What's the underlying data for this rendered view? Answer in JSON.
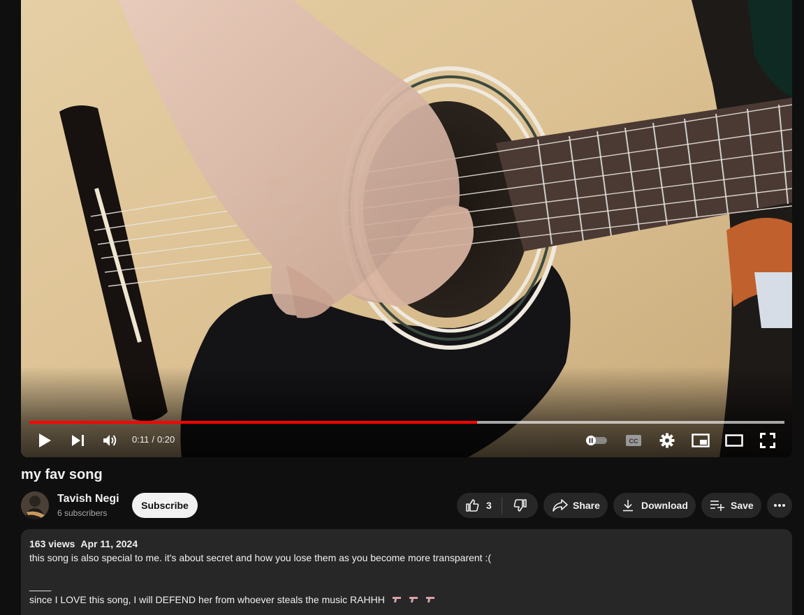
{
  "player": {
    "progress_fraction": 0.593,
    "current_time": "0:11",
    "separator": "/",
    "duration": "0:20",
    "icons": [
      "play-icon",
      "next-icon",
      "volume-icon",
      "autoplay-toggle-icon",
      "captions-icon",
      "settings-icon",
      "miniplayer-icon",
      "theater-icon",
      "fullscreen-icon"
    ],
    "colors": {
      "played": "#ff0000"
    }
  },
  "video": {
    "title": "my fav song"
  },
  "channel": {
    "name": "Tavish Negi",
    "subscribers": "6 subscribers",
    "subscribe_label": "Subscribe"
  },
  "actions": {
    "like_count": "3",
    "share_label": "Share",
    "download_label": "Download",
    "save_label": "Save"
  },
  "description": {
    "views": "163 views",
    "date": "Apr 11, 2024",
    "line1": "this song is also special to me. it's about secret and how you lose them as you become more transparent :(",
    "line2": "____",
    "line3": "since I LOVE this song, I will DEFEND her from whoever steals the music RAHHH",
    "emoji_icons": [
      "gun-icon",
      "gun-icon",
      "gun-icon"
    ]
  }
}
